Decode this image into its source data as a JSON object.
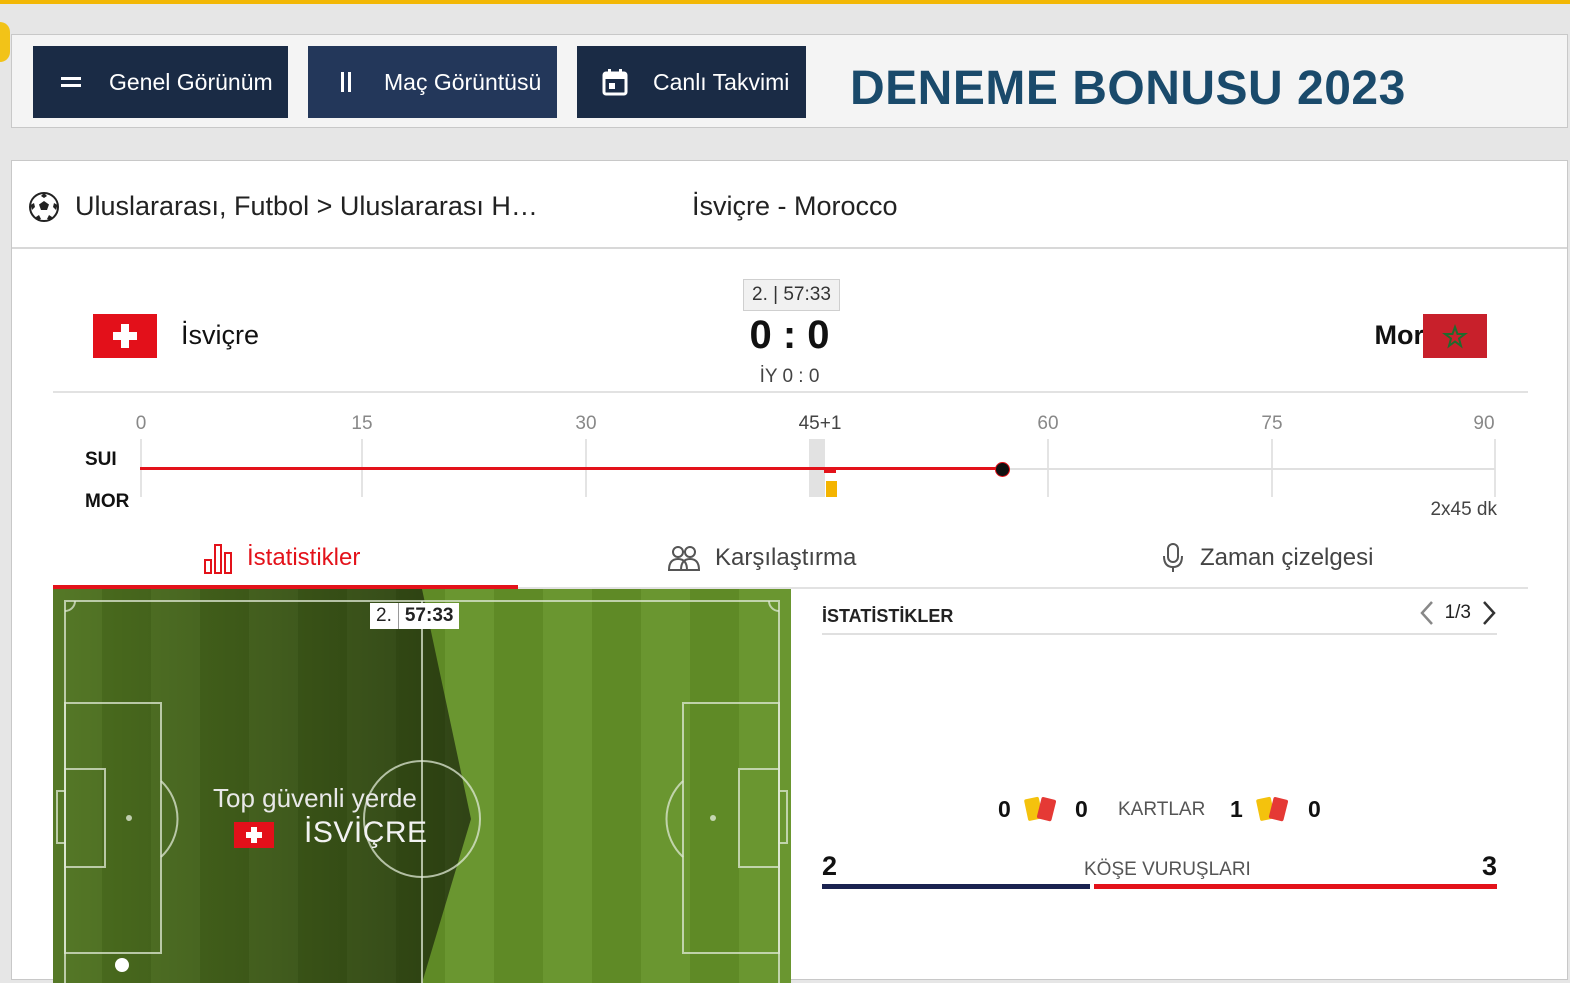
{
  "toolbar": {
    "overview_label": "Genel Görünüm",
    "match_view_label": "Maç Görüntüsü",
    "calendar_label": "Canlı Takvimi",
    "brand": "DENEME BONUSU 2023"
  },
  "breadcrumb": {
    "path": "Uluslararası, Futbol > Uluslararası H…",
    "match_title": "İsviçre - Morocco"
  },
  "match": {
    "clock": "2. | 57:33",
    "home_team": "İsviçre",
    "away_team": "Morocco",
    "score": "0 : 0",
    "halftime": "İY 0 : 0",
    "home_abbr": "SUI",
    "away_abbr": "MOR",
    "duration": "2x45 dk",
    "progress_minute": 57,
    "ticks": [
      "0",
      "15",
      "30",
      "45+1",
      "60",
      "75",
      "90"
    ]
  },
  "tabs": [
    {
      "label": "İstatistikler",
      "active": true
    },
    {
      "label": "Karşılaştırma",
      "active": false
    },
    {
      "label": "Zaman çizelgesi",
      "active": false
    }
  ],
  "pitch": {
    "period": "2.",
    "time": "57:33",
    "message": "Top güvenli yerde",
    "team": "İSVİÇRE"
  },
  "stats": {
    "title": "İSTATİSTİKLER",
    "page": "1/3",
    "cards": {
      "label": "KARTLAR",
      "home_yellow": "0",
      "home_red": "0",
      "away_yellow": "1",
      "away_red": "0"
    },
    "corners": {
      "label": "KÖŞE VURUŞLARI",
      "home": "2",
      "away": "3"
    }
  },
  "colors": {
    "accent_red": "#e3121a",
    "navy": "#1a2b45",
    "brand_blue": "#1a4a6b",
    "pitch_green": "#5f8a26"
  }
}
